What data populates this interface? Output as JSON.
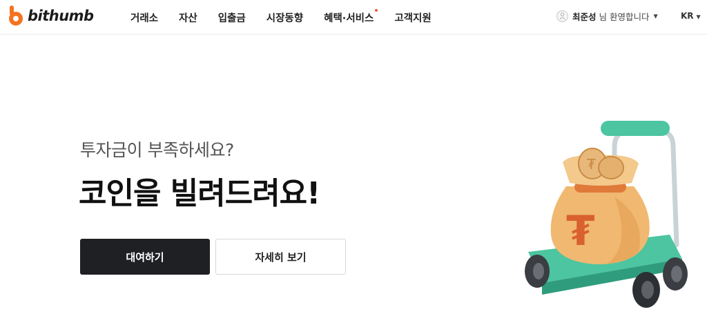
{
  "header": {
    "logo_text": "bithumb",
    "nav": [
      {
        "label": "거래소"
      },
      {
        "label": "자산"
      },
      {
        "label": "입출금"
      },
      {
        "label": "시장동향"
      },
      {
        "label": "혜택·서비스"
      },
      {
        "label": "고객지원"
      }
    ],
    "user": {
      "name": "최준성",
      "greeting": "님 환영합니다"
    },
    "language": "KR"
  },
  "hero": {
    "subtitle": "투자금이 부족하세요?",
    "title": "코인을 빌려드려요!",
    "primary_button": "대여하기",
    "secondary_button": "자세히 보기"
  },
  "colors": {
    "brand_orange": "#f37321",
    "primary_button_bg": "#1f2024",
    "notification_dot": "#f25a3c",
    "cart_green": "#4cc5a0"
  },
  "icons": {
    "logo": "bithumb-logo-icon",
    "avatar": "user-avatar-icon",
    "dropdown": "chevron-down-icon",
    "illustration": "money-bag-cart-illustration"
  }
}
